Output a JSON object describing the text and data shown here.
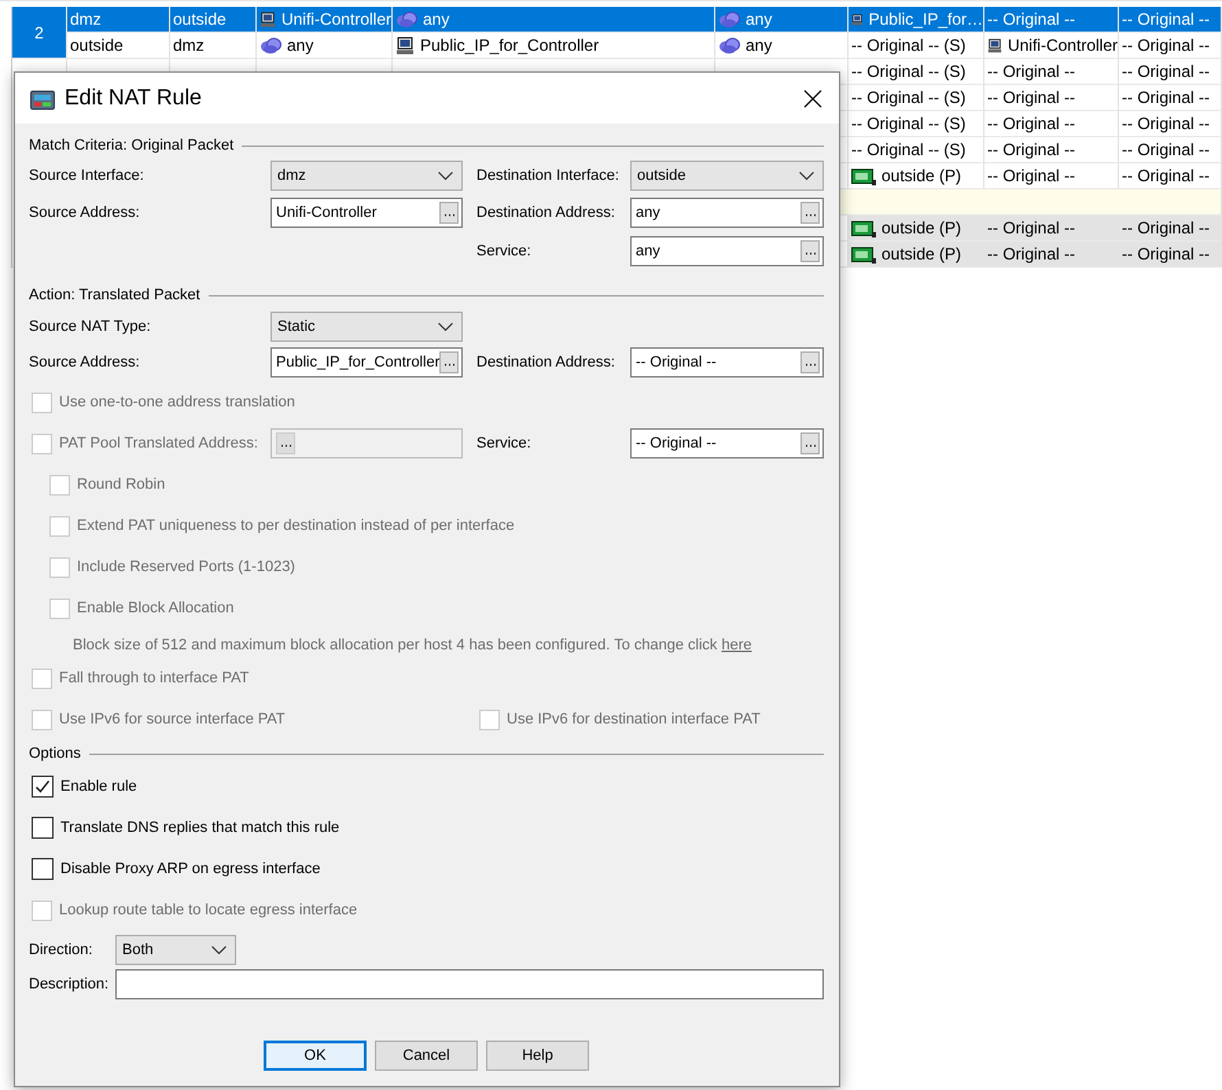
{
  "table": {
    "rules": [
      {
        "number": "2",
        "selected": true,
        "lines": [
          {
            "kind": "rule",
            "cells": [
              {
                "text": "dmz"
              },
              {
                "text": "outside"
              },
              {
                "kind": "host",
                "text": "Unifi-Controller"
              },
              {
                "kind": "network",
                "text": "any"
              },
              {
                "kind": "network",
                "text": "any"
              },
              {
                "kind": "host",
                "text": "Public_IP_for…"
              },
              {
                "text": "-- Original --"
              },
              {
                "text": "-- Original --"
              }
            ]
          },
          {
            "kind": "rule",
            "cells": [
              {
                "text": "outside"
              },
              {
                "text": "dmz"
              },
              {
                "kind": "network",
                "text": "any"
              },
              {
                "kind": "host",
                "text": "Public_IP_for_Controller"
              },
              {
                "kind": "network",
                "text": "any"
              },
              {
                "text": "-- Original -- (S)"
              },
              {
                "kind": "host",
                "text": "Unifi-Controller"
              },
              {
                "text": "-- Original --"
              }
            ]
          }
        ]
      },
      {
        "selected": false,
        "lines": [
          {
            "kind": "rule",
            "cells": [
              {
                "text": "-- Original -- (S)"
              },
              {
                "text": "-- Original --"
              },
              {
                "text": "-- Original --"
              }
            ]
          },
          {
            "kind": "rule",
            "cells": [
              {
                "text": "-- Original -- (S)"
              },
              {
                "text": "-- Original --"
              },
              {
                "text": "-- Original --"
              }
            ]
          },
          {
            "kind": "rule",
            "cells": [
              {
                "text": "-- Original -- (S)"
              },
              {
                "text": "-- Original --"
              },
              {
                "text": "-- Original --"
              }
            ]
          },
          {
            "kind": "rule",
            "cells": [
              {
                "text": "-- Original -- (S)"
              },
              {
                "text": "-- Original --"
              },
              {
                "text": "-- Original --"
              }
            ]
          },
          {
            "kind": "rule",
            "cells": [
              {
                "kind": "interface",
                "text": "outside (P)"
              },
              {
                "text": "-- Original --"
              },
              {
                "text": "-- Original --"
              }
            ]
          },
          {
            "kind": "section"
          },
          {
            "kind": "inactive",
            "cells": [
              {
                "kind": "interface",
                "text": "outside (P)"
              },
              {
                "text": "-- Original --"
              },
              {
                "text": "-- Original --"
              }
            ]
          },
          {
            "kind": "inactive",
            "cells": [
              {
                "kind": "interface",
                "text": "outside (P)"
              },
              {
                "text": "-- Original --"
              },
              {
                "text": "-- Original --"
              }
            ]
          }
        ]
      }
    ]
  },
  "dialog": {
    "title": "Edit NAT Rule",
    "match": {
      "title": "Match Criteria: Original Packet",
      "source_interface": {
        "label": "Source Interface:",
        "value": "dmz"
      },
      "destination_interface": {
        "label": "Destination Interface:",
        "value": "outside"
      },
      "source_address": {
        "label": "Source Address:",
        "value": "Unifi-Controller"
      },
      "destination_address": {
        "label": "Destination Address:",
        "value": "any"
      },
      "service": {
        "label": "Service:",
        "value": "any"
      }
    },
    "action": {
      "title": "Action: Translated Packet",
      "source_nat_type": {
        "label": "Source NAT Type:",
        "value": "Static"
      },
      "source_address": {
        "label": "Source Address:",
        "value": "Public_IP_for_Controller"
      },
      "destination_address": {
        "label": "Destination Address:",
        "value": "-- Original --"
      },
      "one_to_one": {
        "label": "Use one-to-one address translation",
        "checked": false,
        "disabled": true
      },
      "pat_pool": {
        "label": "PAT Pool Translated Address:",
        "checked": false,
        "disabled": true
      },
      "service": {
        "label": "Service:",
        "value": "-- Original --"
      },
      "round_robin": {
        "label": "Round Robin",
        "checked": false,
        "disabled": true
      },
      "extend_pat": {
        "label": "Extend PAT uniqueness to per destination instead of per interface",
        "checked": false,
        "disabled": true
      },
      "reserved_ports": {
        "label": "Include Reserved Ports (1-1023)",
        "checked": false,
        "disabled": true
      },
      "block_allocation": {
        "label": "Enable Block Allocation",
        "checked": false,
        "disabled": true
      },
      "block_note": {
        "text": "Block size of 512 and maximum block allocation per host 4 has been configured. To change click",
        "link": "here"
      },
      "fall_through": {
        "label": "Fall through to interface PAT",
        "checked": false,
        "disabled": true
      },
      "ipv6_source": {
        "label": "Use IPv6 for source interface PAT",
        "checked": false,
        "disabled": true
      },
      "ipv6_destination": {
        "label": "Use IPv6 for destination interface PAT",
        "checked": false,
        "disabled": true
      }
    },
    "options": {
      "title": "Options",
      "enable_rule": {
        "label": "Enable rule",
        "checked": true,
        "disabled": false
      },
      "translate_dns": {
        "label": "Translate DNS replies that match this rule",
        "checked": false,
        "disabled": false
      },
      "disable_proxy_arp": {
        "label": "Disable Proxy ARP on egress interface",
        "checked": false,
        "disabled": false
      },
      "lookup_route": {
        "label": "Lookup route table to locate egress interface",
        "checked": false,
        "disabled": true
      },
      "direction": {
        "label": "Direction:",
        "value": "Both"
      },
      "description": {
        "label": "Description:"
      }
    },
    "buttons": [
      {
        "label": "OK",
        "default": true
      },
      {
        "label": "Cancel",
        "default": false
      },
      {
        "label": "Help",
        "default": false
      }
    ]
  }
}
